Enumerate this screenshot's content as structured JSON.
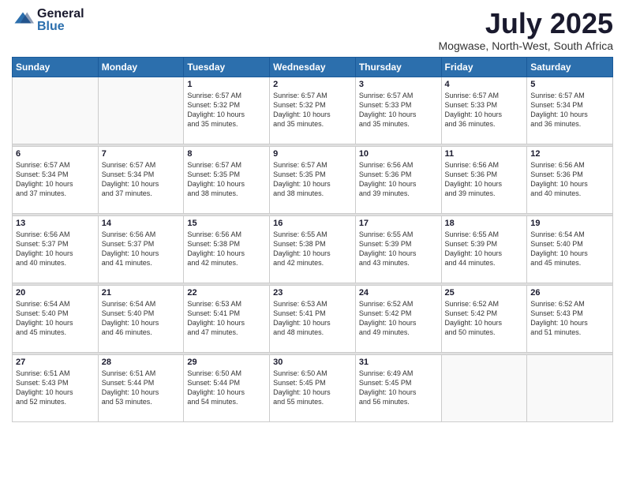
{
  "header": {
    "logo": {
      "general": "General",
      "blue": "Blue"
    },
    "title": "July 2025",
    "location": "Mogwase, North-West, South Africa"
  },
  "weekdays": [
    "Sunday",
    "Monday",
    "Tuesday",
    "Wednesday",
    "Thursday",
    "Friday",
    "Saturday"
  ],
  "weeks": [
    [
      {
        "day": "",
        "info": ""
      },
      {
        "day": "",
        "info": ""
      },
      {
        "day": "1",
        "info": "Sunrise: 6:57 AM\nSunset: 5:32 PM\nDaylight: 10 hours\nand 35 minutes."
      },
      {
        "day": "2",
        "info": "Sunrise: 6:57 AM\nSunset: 5:32 PM\nDaylight: 10 hours\nand 35 minutes."
      },
      {
        "day": "3",
        "info": "Sunrise: 6:57 AM\nSunset: 5:33 PM\nDaylight: 10 hours\nand 35 minutes."
      },
      {
        "day": "4",
        "info": "Sunrise: 6:57 AM\nSunset: 5:33 PM\nDaylight: 10 hours\nand 36 minutes."
      },
      {
        "day": "5",
        "info": "Sunrise: 6:57 AM\nSunset: 5:34 PM\nDaylight: 10 hours\nand 36 minutes."
      }
    ],
    [
      {
        "day": "6",
        "info": "Sunrise: 6:57 AM\nSunset: 5:34 PM\nDaylight: 10 hours\nand 37 minutes."
      },
      {
        "day": "7",
        "info": "Sunrise: 6:57 AM\nSunset: 5:34 PM\nDaylight: 10 hours\nand 37 minutes."
      },
      {
        "day": "8",
        "info": "Sunrise: 6:57 AM\nSunset: 5:35 PM\nDaylight: 10 hours\nand 38 minutes."
      },
      {
        "day": "9",
        "info": "Sunrise: 6:57 AM\nSunset: 5:35 PM\nDaylight: 10 hours\nand 38 minutes."
      },
      {
        "day": "10",
        "info": "Sunrise: 6:56 AM\nSunset: 5:36 PM\nDaylight: 10 hours\nand 39 minutes."
      },
      {
        "day": "11",
        "info": "Sunrise: 6:56 AM\nSunset: 5:36 PM\nDaylight: 10 hours\nand 39 minutes."
      },
      {
        "day": "12",
        "info": "Sunrise: 6:56 AM\nSunset: 5:36 PM\nDaylight: 10 hours\nand 40 minutes."
      }
    ],
    [
      {
        "day": "13",
        "info": "Sunrise: 6:56 AM\nSunset: 5:37 PM\nDaylight: 10 hours\nand 40 minutes."
      },
      {
        "day": "14",
        "info": "Sunrise: 6:56 AM\nSunset: 5:37 PM\nDaylight: 10 hours\nand 41 minutes."
      },
      {
        "day": "15",
        "info": "Sunrise: 6:56 AM\nSunset: 5:38 PM\nDaylight: 10 hours\nand 42 minutes."
      },
      {
        "day": "16",
        "info": "Sunrise: 6:55 AM\nSunset: 5:38 PM\nDaylight: 10 hours\nand 42 minutes."
      },
      {
        "day": "17",
        "info": "Sunrise: 6:55 AM\nSunset: 5:39 PM\nDaylight: 10 hours\nand 43 minutes."
      },
      {
        "day": "18",
        "info": "Sunrise: 6:55 AM\nSunset: 5:39 PM\nDaylight: 10 hours\nand 44 minutes."
      },
      {
        "day": "19",
        "info": "Sunrise: 6:54 AM\nSunset: 5:40 PM\nDaylight: 10 hours\nand 45 minutes."
      }
    ],
    [
      {
        "day": "20",
        "info": "Sunrise: 6:54 AM\nSunset: 5:40 PM\nDaylight: 10 hours\nand 45 minutes."
      },
      {
        "day": "21",
        "info": "Sunrise: 6:54 AM\nSunset: 5:40 PM\nDaylight: 10 hours\nand 46 minutes."
      },
      {
        "day": "22",
        "info": "Sunrise: 6:53 AM\nSunset: 5:41 PM\nDaylight: 10 hours\nand 47 minutes."
      },
      {
        "day": "23",
        "info": "Sunrise: 6:53 AM\nSunset: 5:41 PM\nDaylight: 10 hours\nand 48 minutes."
      },
      {
        "day": "24",
        "info": "Sunrise: 6:52 AM\nSunset: 5:42 PM\nDaylight: 10 hours\nand 49 minutes."
      },
      {
        "day": "25",
        "info": "Sunrise: 6:52 AM\nSunset: 5:42 PM\nDaylight: 10 hours\nand 50 minutes."
      },
      {
        "day": "26",
        "info": "Sunrise: 6:52 AM\nSunset: 5:43 PM\nDaylight: 10 hours\nand 51 minutes."
      }
    ],
    [
      {
        "day": "27",
        "info": "Sunrise: 6:51 AM\nSunset: 5:43 PM\nDaylight: 10 hours\nand 52 minutes."
      },
      {
        "day": "28",
        "info": "Sunrise: 6:51 AM\nSunset: 5:44 PM\nDaylight: 10 hours\nand 53 minutes."
      },
      {
        "day": "29",
        "info": "Sunrise: 6:50 AM\nSunset: 5:44 PM\nDaylight: 10 hours\nand 54 minutes."
      },
      {
        "day": "30",
        "info": "Sunrise: 6:50 AM\nSunset: 5:45 PM\nDaylight: 10 hours\nand 55 minutes."
      },
      {
        "day": "31",
        "info": "Sunrise: 6:49 AM\nSunset: 5:45 PM\nDaylight: 10 hours\nand 56 minutes."
      },
      {
        "day": "",
        "info": ""
      },
      {
        "day": "",
        "info": ""
      }
    ]
  ]
}
